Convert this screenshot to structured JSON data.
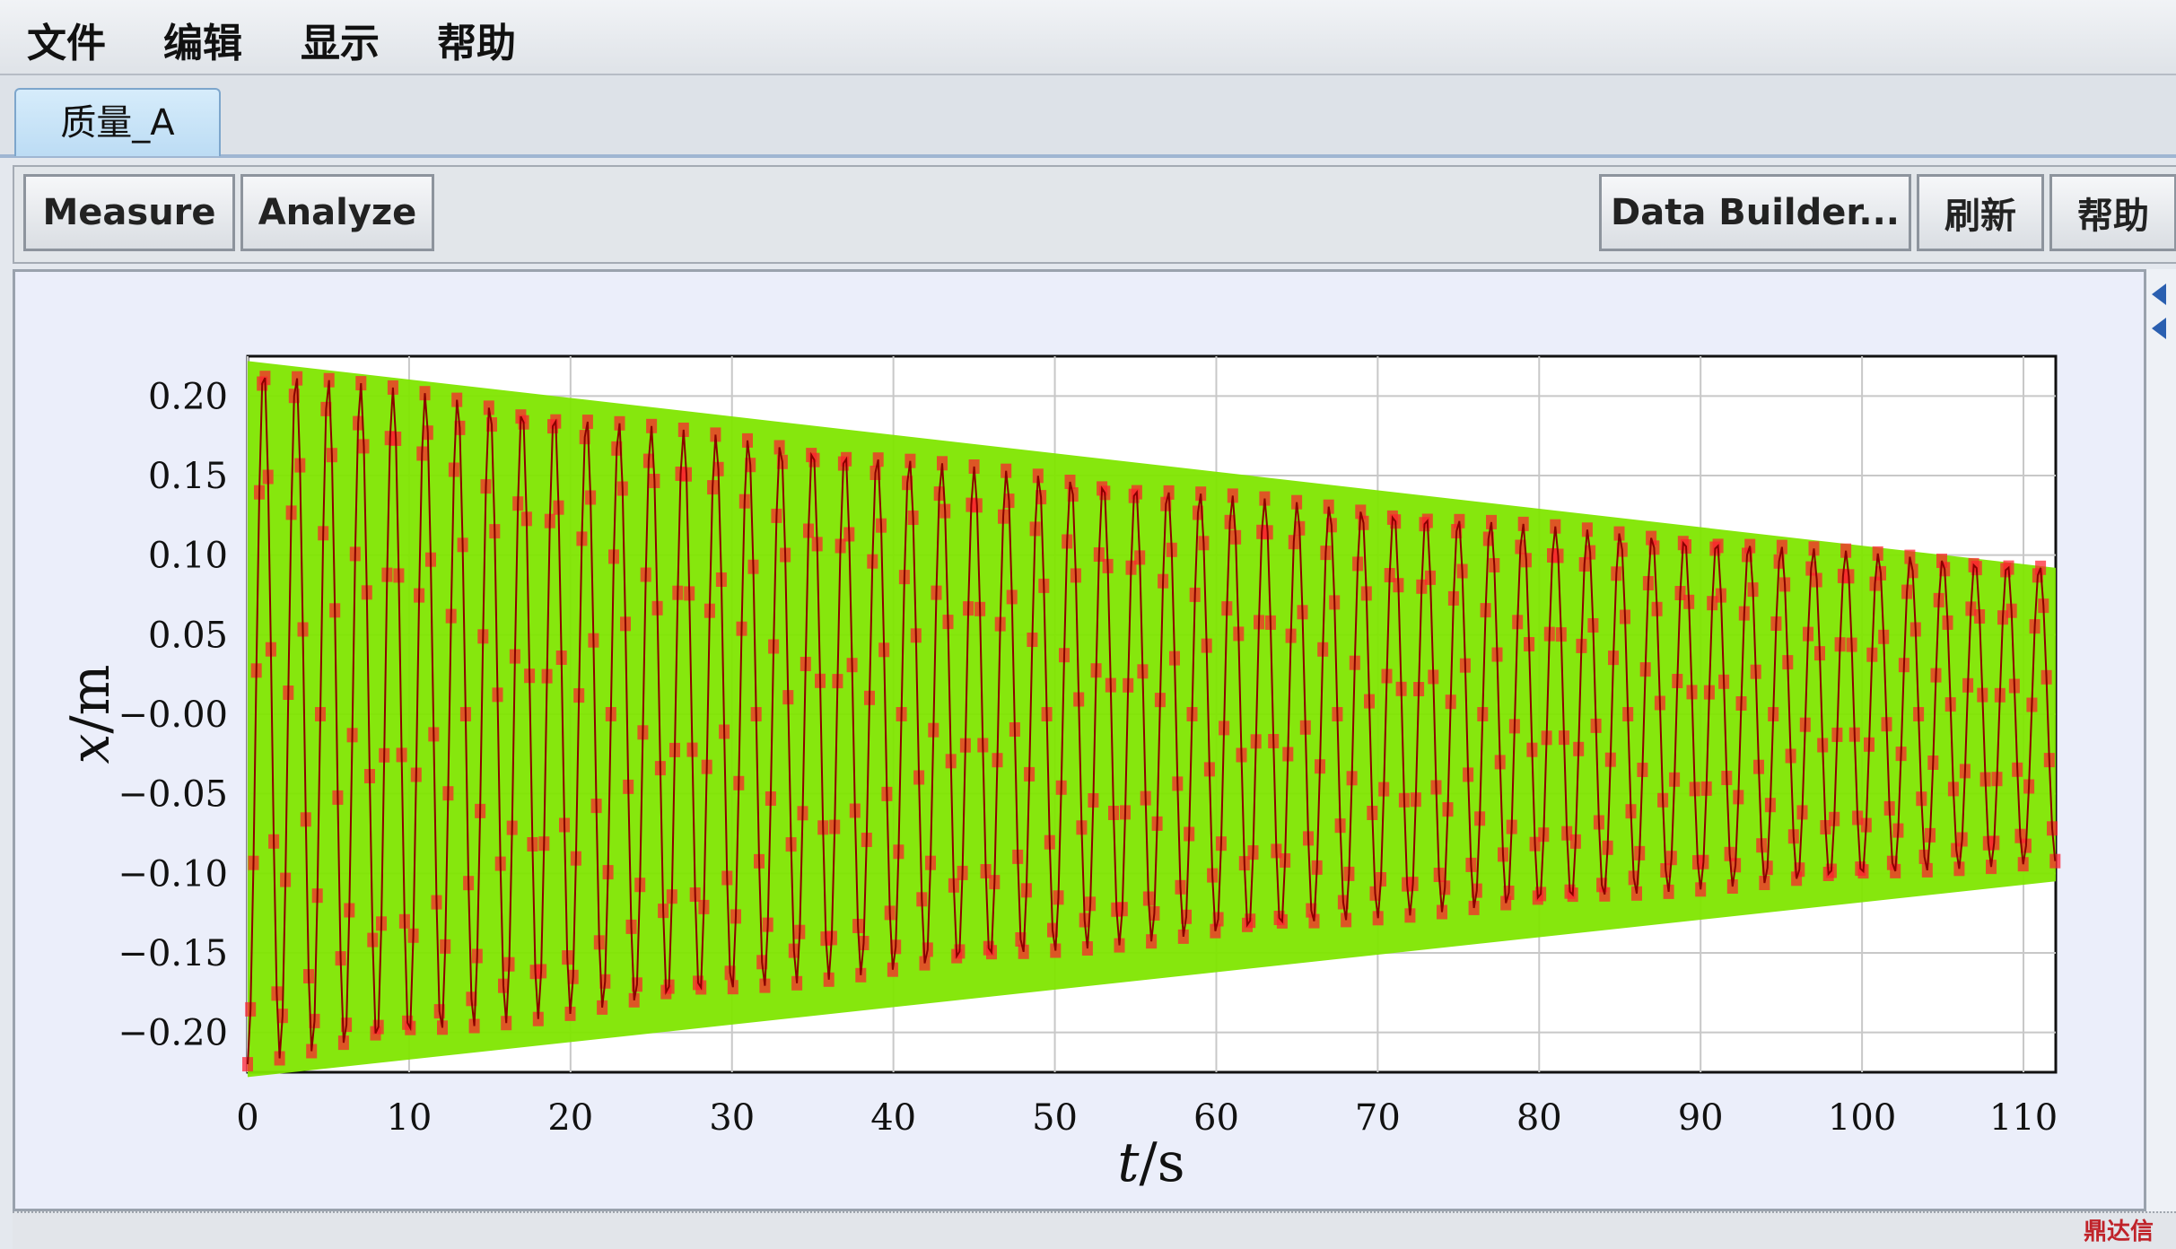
{
  "menu": {
    "items": [
      "文件",
      "编辑",
      "显示",
      "帮助"
    ]
  },
  "tabs": [
    {
      "label": "质量_A",
      "active": true
    }
  ],
  "toolbar": {
    "measure_label": "Measure",
    "analyze_label": "Analyze",
    "data_builder_label": "Data Builder...",
    "refresh_label": "刷新",
    "help_label": "帮助"
  },
  "watermark": "鼎达信",
  "colors": {
    "envelope": "#7fe600",
    "markers": "#ff1f2f",
    "trace": "#8a0000",
    "grid": "#c8c8c8"
  },
  "chart_data": {
    "type": "scatter",
    "xlabel_var": "t",
    "xlabel_unit": "/s",
    "ylabel_var": "x",
    "ylabel_unit": "/m",
    "xlim": [
      0,
      112
    ],
    "ylim": [
      -0.225,
      0.225
    ],
    "x_ticks": [
      "0",
      "10",
      "20",
      "30",
      "40",
      "50",
      "60",
      "70",
      "80",
      "90",
      "100",
      "110"
    ],
    "y_ticks": [
      "0.20",
      "0.15",
      "0.10",
      "0.05",
      "−0.00",
      "−0.05",
      "−0.10",
      "−0.15",
      "−0.20"
    ],
    "grid": true,
    "series": [
      {
        "description": "measured displacement x(t), damped oscillation",
        "period": 2.0,
        "amplitude_start": 0.22,
        "amplitude_end": 0.093,
        "t_end": 112
      },
      {
        "description": "envelope band",
        "upper": [
          [
            0,
            0.222
          ],
          [
            112,
            0.092
          ]
        ],
        "lower": [
          [
            0,
            -0.228
          ],
          [
            112,
            -0.105
          ]
        ]
      }
    ]
  }
}
